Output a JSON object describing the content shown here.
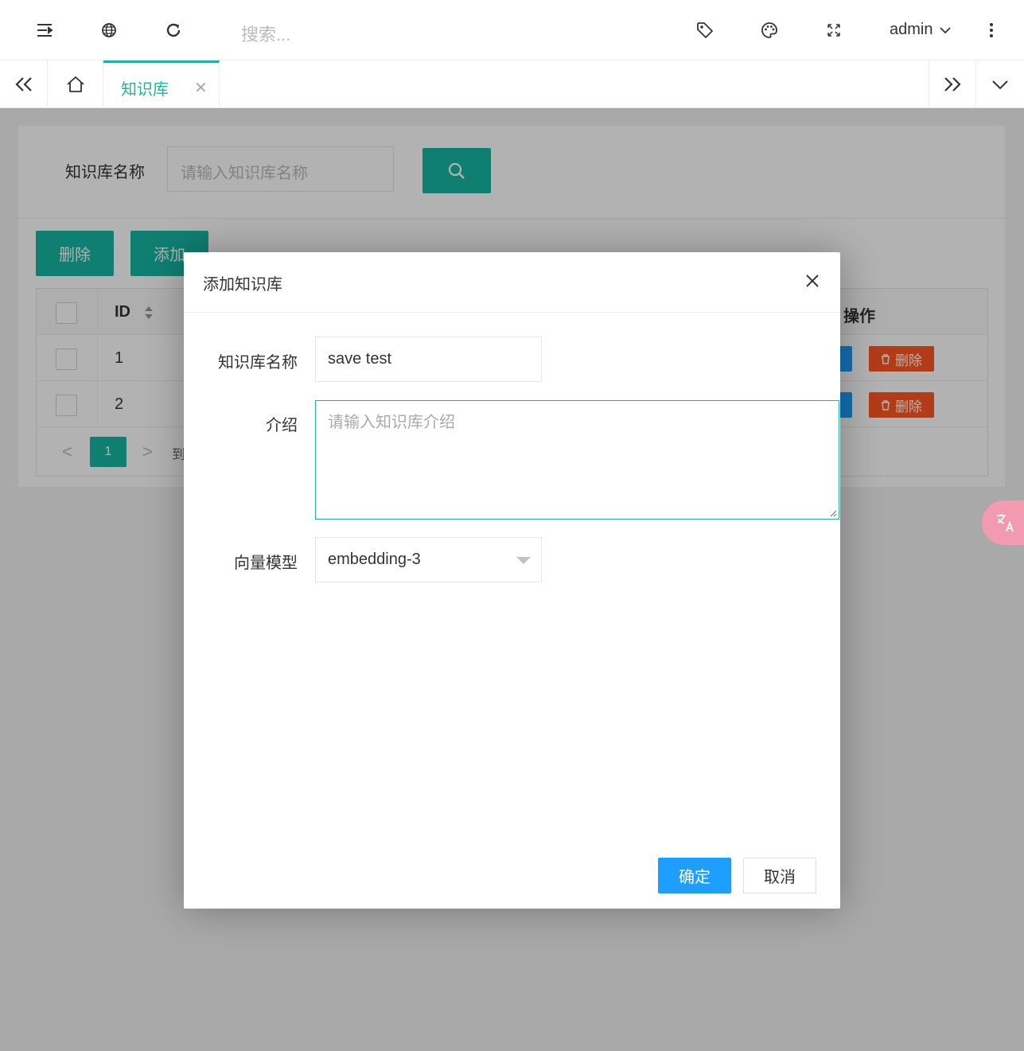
{
  "topbar": {
    "search_placeholder": "搜索...",
    "username": "admin",
    "icons": [
      "menu-fold-icon",
      "globe-icon",
      "refresh-icon",
      "tag-icon",
      "palette-icon",
      "fullscreen-icon",
      "chevron-down-icon",
      "more-vertical-icon"
    ]
  },
  "tabs": {
    "items": [
      {
        "label": "知识库",
        "active": true
      }
    ],
    "accent_color": "#16b6a3"
  },
  "page": {
    "filter_label": "知识库名称",
    "filter_placeholder": "请输入知识库名称",
    "delete_button": "删除",
    "add_button": "添加",
    "table": {
      "columns": [
        "ID",
        "操作"
      ],
      "rows": [
        {
          "id": "1",
          "delete": "删除"
        },
        {
          "id": "2",
          "delete": "删除"
        }
      ]
    },
    "pagination": {
      "current_page": "1",
      "goto_label": "到"
    }
  },
  "modal": {
    "title": "添加知识库",
    "fields": {
      "name_label": "知识库名称",
      "name_value": "save test",
      "intro_label": "介绍",
      "intro_placeholder": "请输入知识库介绍",
      "model_label": "向量模型",
      "model_value": "embedding-3"
    },
    "confirm": "确定",
    "cancel": "取消"
  },
  "colors": {
    "primary": "#16b6a3",
    "blue": "#1e9fff",
    "danger": "#ff5722"
  }
}
